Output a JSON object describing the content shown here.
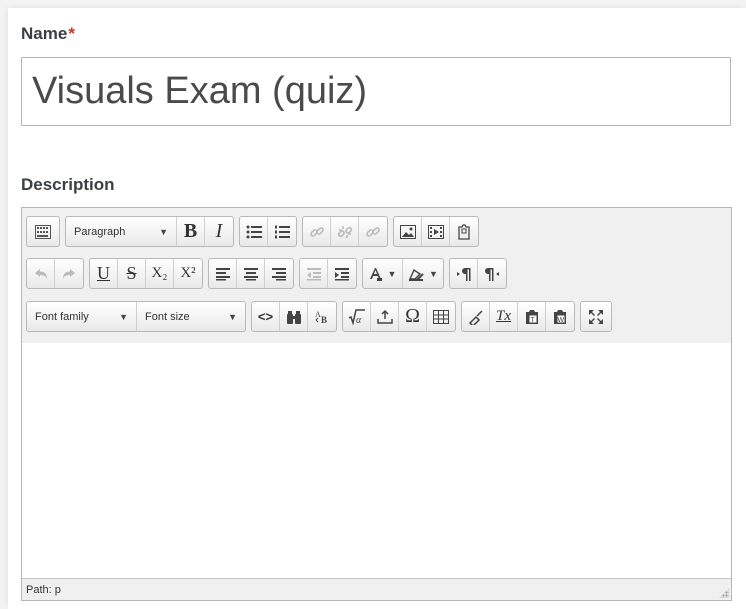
{
  "form": {
    "name_label": "Name",
    "required_marker": "*",
    "name_value": "Visuals Exam (quiz)",
    "description_label": "Description"
  },
  "toolbar": {
    "paragraph_select": "Paragraph",
    "font_family_select": "Font family",
    "font_size_select": "Font size",
    "bold_glyph": "B",
    "italic_glyph": "I",
    "underline_glyph": "U",
    "strikethrough_glyph": "S",
    "subscript_glyph": "X₂",
    "superscript_glyph": "X²",
    "code_glyph": "<>",
    "omega_glyph": "Ω",
    "clear_format_glyph": "Tx"
  },
  "statusbar": {
    "path_text": "Path: p"
  },
  "colors": {
    "required": "#c0392b",
    "label": "#3b4044",
    "border": "#b5b5b5",
    "toolbar_bg": "#f0f0f0"
  }
}
